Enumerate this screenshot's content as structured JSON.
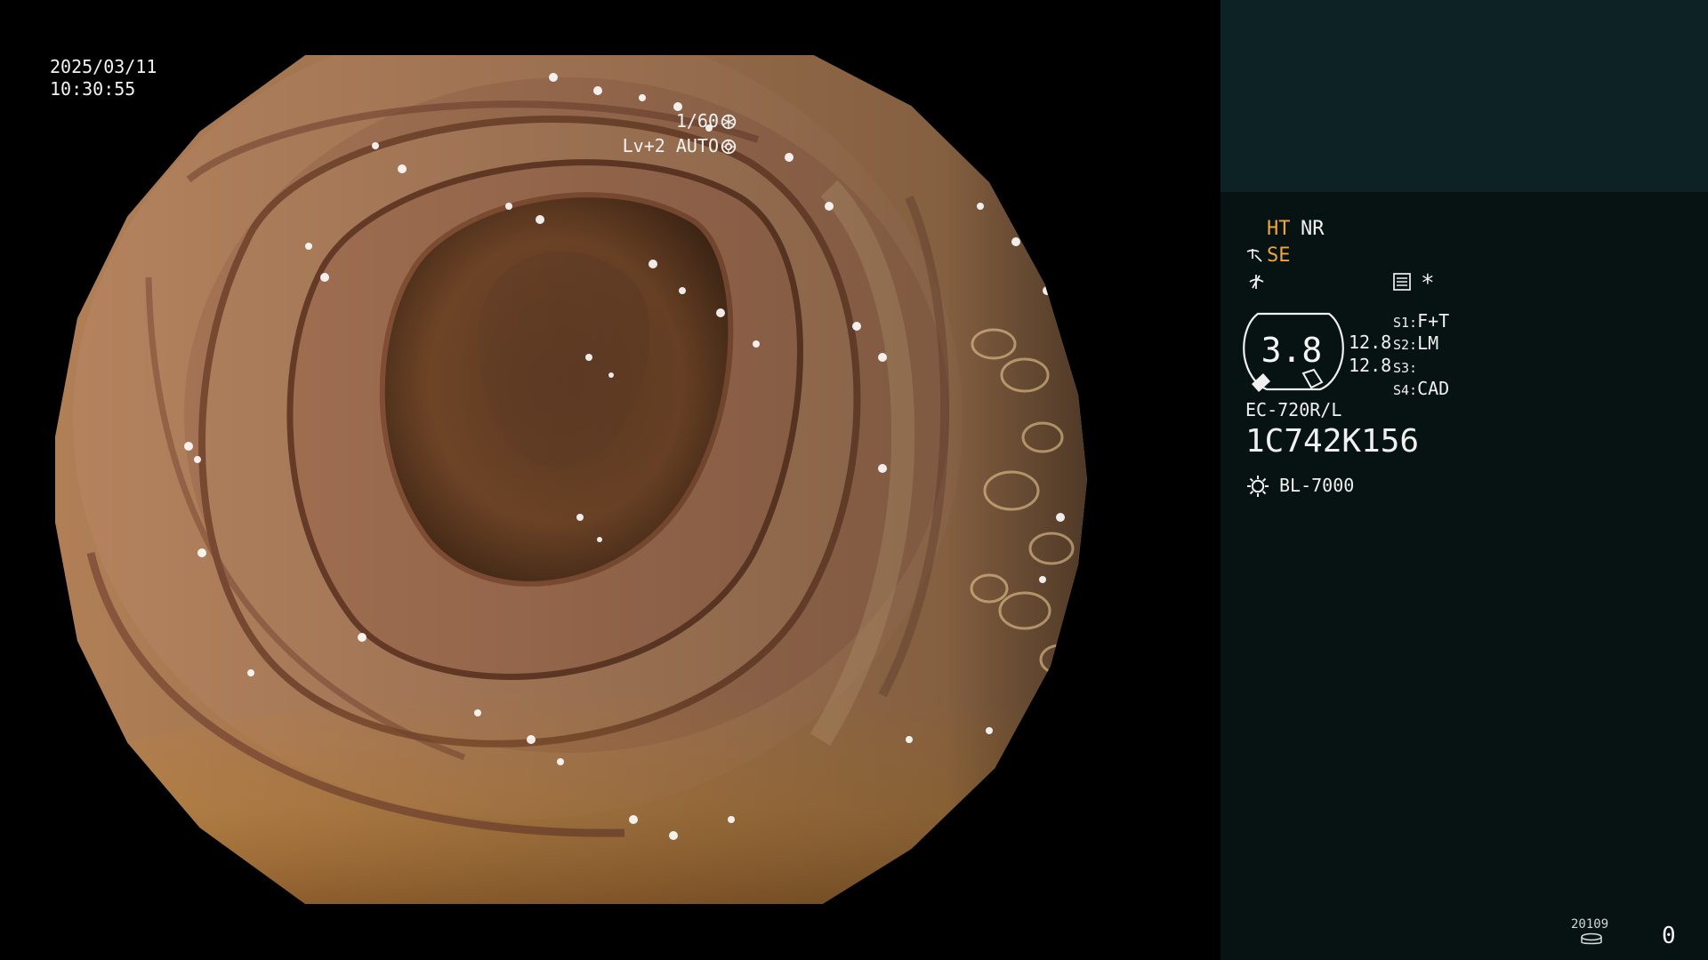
{
  "overlay": {
    "date": "2025/03/11",
    "time": "10:30:55",
    "shutter": "1/60",
    "level": "Lv+2 AUTO"
  },
  "panel": {
    "modes": {
      "ht": "HT",
      "nr": "NR",
      "se": "SE"
    },
    "asterisk": "*",
    "gauge": {
      "value": "3.8",
      "upper": "12.8",
      "lower": "12.8"
    },
    "switches": [
      {
        "key": "S1:",
        "value": "F+T"
      },
      {
        "key": "S2:",
        "value": "LM"
      },
      {
        "key": "S3:",
        "value": ""
      },
      {
        "key": "S4:",
        "value": "CAD"
      }
    ],
    "scope_model": "EC-720R/L",
    "scope_serial": "1C742K156",
    "light_source": "BL-7000",
    "footer_code": "20109",
    "footer_count": "0"
  },
  "icons": {
    "shutter": "aperture-icon",
    "auto": "iris-icon",
    "se": "structure-enhancement-icon",
    "enhancement": "enhancement-icon",
    "menu": "menu-list-icon",
    "light": "light-source-icon",
    "footer": "storage-icon"
  },
  "colors": {
    "panel_background": "#071312",
    "panel_top_background": "#0c2224",
    "mode_orange": "#f1a43a",
    "text": "#f0f0f0"
  }
}
